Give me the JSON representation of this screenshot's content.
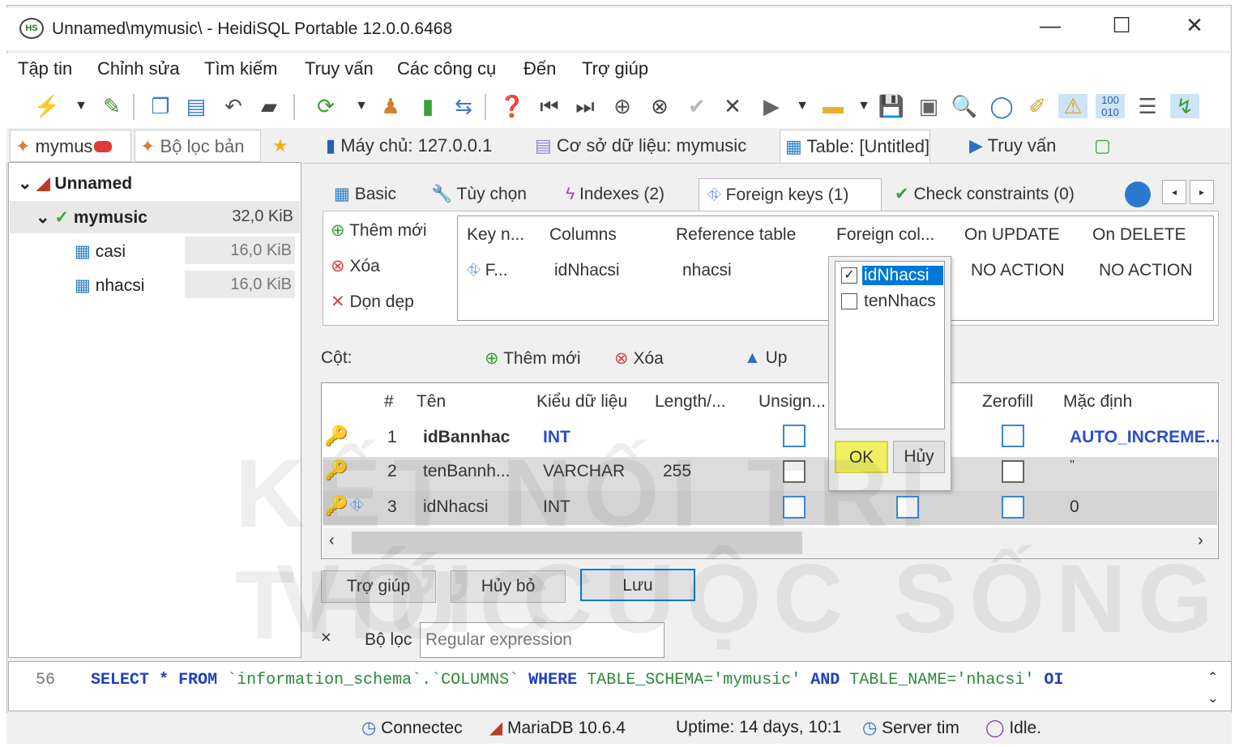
{
  "window": {
    "title": "Unnamed\\mymusic\\ - HeidiSQL Portable 12.0.0.6468",
    "app_icon": "HS",
    "minimize": "—",
    "maximize": "☐",
    "close": "✕"
  },
  "menu": [
    "Tập tin",
    "Chỉnh sửa",
    "Tìm kiếm",
    "Truy vấn",
    "Các công cụ",
    "Đến",
    "Trợ giúp"
  ],
  "toolbar_icons": [
    "connect-icon",
    "dropdown-icon",
    "disconnect-icon",
    "copy-icon",
    "paste-icon",
    "undo-icon",
    "print-icon",
    "refresh-icon",
    "dropdown-icon",
    "users-icon",
    "export-icon",
    "import-icon",
    "help-icon",
    "first-icon",
    "last-icon",
    "add-icon",
    "remove-icon",
    "apply-icon",
    "cancel-icon",
    "run-icon",
    "dropdown-icon",
    "folder-icon",
    "dropdown-icon",
    "save-icon",
    "save-sql-icon",
    "find-icon",
    "find-replace-icon",
    "clear-icon",
    "log-icon",
    "binary-icon",
    "wrap-icon",
    "reconnect-icon"
  ],
  "left_tabs": {
    "db_tab": "mymus",
    "filter_tab": "Bộ lọc bản"
  },
  "main_tabs": {
    "host": "Máy chủ: 127.0.0.1",
    "database": "Cơ sở dữ liệu: mymusic",
    "table": "Table: [Untitled]",
    "query": "Truy vấn"
  },
  "tree": {
    "root": "Unnamed",
    "db": {
      "name": "mymusic",
      "size": "32,0 KiB"
    },
    "tables": [
      {
        "name": "casi",
        "size": "16,0 KiB"
      },
      {
        "name": "nhacsi",
        "size": "16,0 KiB"
      }
    ]
  },
  "subtabs": {
    "basic": "Basic",
    "options": "Tùy chọn",
    "indexes": "Indexes (2)",
    "foreign": "Foreign keys (1)",
    "check": "Check constraints (0)"
  },
  "fk_actions": {
    "add": "Thêm mới",
    "delete": "Xóa",
    "clear": "Dọn dẹp"
  },
  "fk_table": {
    "headers": [
      "Key n...",
      "Columns",
      "Reference table",
      "Foreign col...",
      "On UPDATE",
      "On DELETE"
    ],
    "row": {
      "key": "F...",
      "columns": "idNhacsi",
      "ref": "nhacsi",
      "on_update": "NO ACTION",
      "on_delete": "NO ACTION"
    }
  },
  "dropdown": {
    "options": [
      {
        "label": "idNhacsi",
        "checked": true
      },
      {
        "label": "tenNhacs",
        "checked": false
      }
    ],
    "ok": "OK",
    "cancel": "Hủy"
  },
  "columns": {
    "label": "Cột:",
    "add": "Thêm mới",
    "delete": "Xóa",
    "up": "Up",
    "headers": {
      "num": "#",
      "name": "Tên",
      "type": "Kiểu dữ liệu",
      "length": "Length/...",
      "unsigned": "Unsign...",
      "zerofill": "Zerofill",
      "default": "Mặc định"
    },
    "rows": [
      {
        "num": "1",
        "name": "idBannhac",
        "type": "INT",
        "length": "",
        "default": "AUTO_INCREME..."
      },
      {
        "num": "2",
        "name": "tenBannh...",
        "type": "VARCHAR",
        "length": "255",
        "default": "''"
      },
      {
        "num": "3",
        "name": "idNhacsi",
        "type": "INT",
        "length": "",
        "default": "0"
      }
    ]
  },
  "bottom_buttons": {
    "help": "Trợ giúp",
    "cancel": "Hủy bỏ",
    "save": "Lưu"
  },
  "filter": {
    "close": "×",
    "label": "Bộ lọc",
    "placeholder": "Regular expression"
  },
  "sql_log": {
    "line": "56",
    "parts": [
      "SELECT",
      "*",
      "FROM",
      "`information_schema`.`COLUMNS`",
      "WHERE",
      "TABLE_SCHEMA='mymusic'",
      "AND",
      "TABLE_NAME='nhacsi'",
      "OI"
    ]
  },
  "statusbar": {
    "connected": "Connectec",
    "server": "MariaDB 10.6.4",
    "uptime": "Uptime: 14 days, 10:1",
    "server_time": "Server tim",
    "idle": "Idle."
  },
  "watermark": {
    "line1": "KẾT NỐI TRI THỨC",
    "line2": "VỚI CUỘC SỐNG"
  },
  "colors": {
    "accent": "#0078d7",
    "keyword": "#1f3fbf",
    "string": "#2a8a3a",
    "ok_button": "#f0f060"
  }
}
